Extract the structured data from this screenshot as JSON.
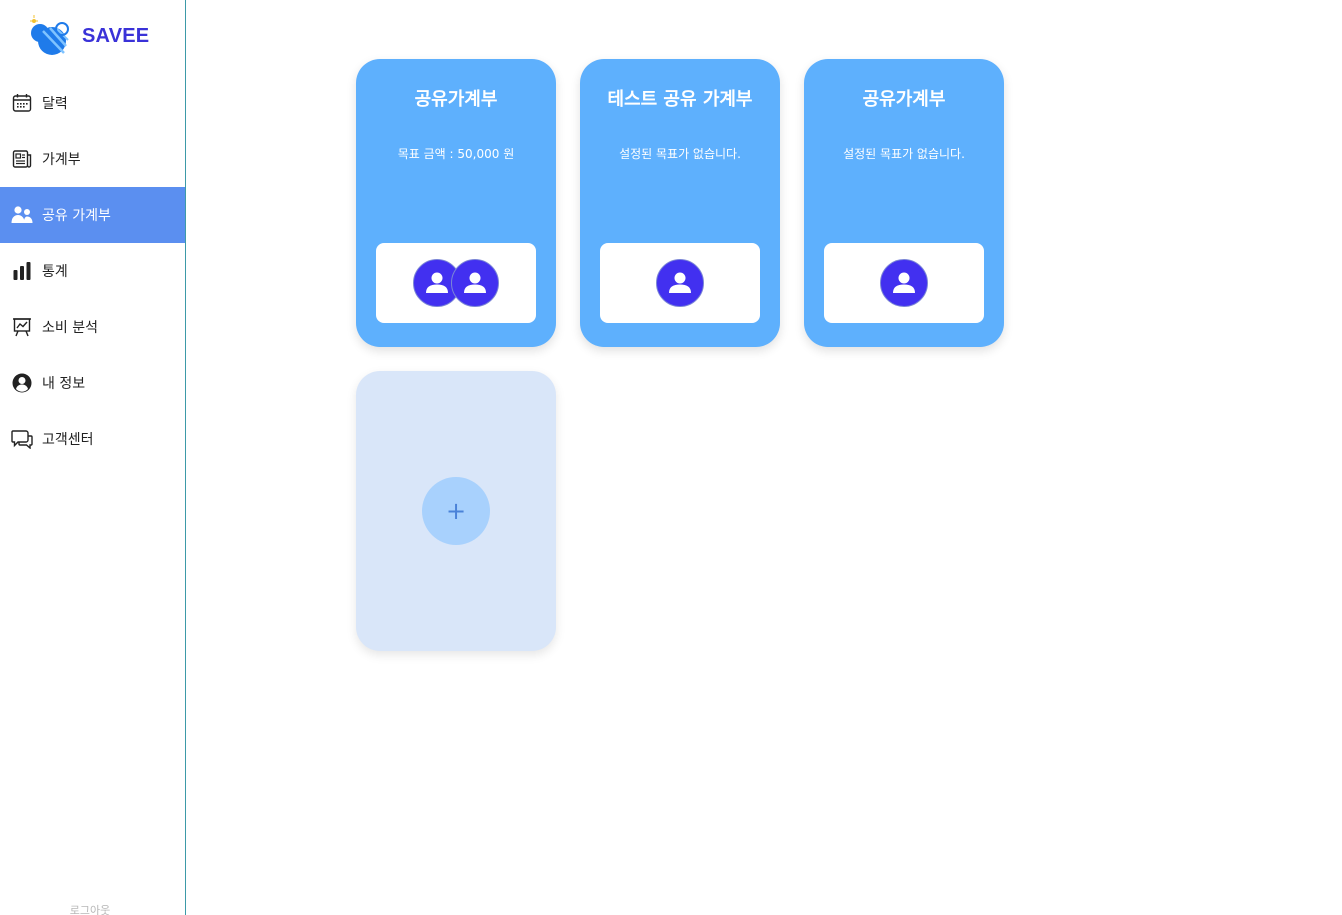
{
  "app": {
    "brand": "SAVEE"
  },
  "sidebar": {
    "items": [
      {
        "label": "달력",
        "icon": "calendar-icon",
        "active": false
      },
      {
        "label": "가계부",
        "icon": "ledger-icon",
        "active": false
      },
      {
        "label": "공유 가계부",
        "icon": "users-icon",
        "active": true
      },
      {
        "label": "통계",
        "icon": "bar-chart-icon",
        "active": false
      },
      {
        "label": "소비 분석",
        "icon": "analysis-board-icon",
        "active": false
      },
      {
        "label": "내 정보",
        "icon": "user-circle-icon",
        "active": false
      },
      {
        "label": "고객센터",
        "icon": "chat-icon",
        "active": false
      }
    ],
    "logout_label": "로그아웃"
  },
  "cards": [
    {
      "title": "공유가계부",
      "goal": "목표 금액 : 50,000 원",
      "member_count": 2
    },
    {
      "title": "테스트 공유 가계부",
      "goal": "설정된 목표가 없습니다.",
      "member_count": 1
    },
    {
      "title": "공유가계부",
      "goal": "설정된 목표가 없습니다.",
      "member_count": 1
    }
  ],
  "add_card": {
    "plus": "+"
  },
  "colors": {
    "accent": "#5b8ff0",
    "card": "#5eb0fd",
    "avatar": "#4230f0",
    "brand": "#3a32d8",
    "add_card": "#d9e6f9"
  }
}
